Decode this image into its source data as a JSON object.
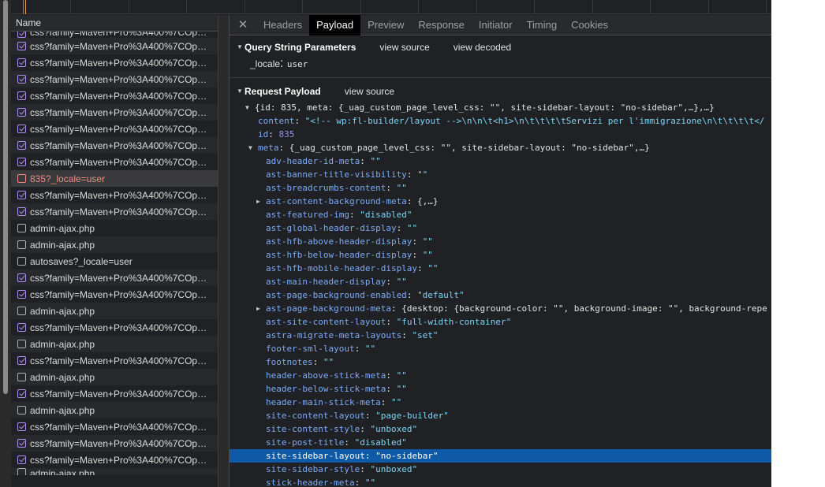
{
  "timeline": {
    "ticks": 13
  },
  "request_list": {
    "header": "Name",
    "rows": [
      {
        "icon": "css-icon",
        "label": "css?family=Maven+Pro%3A400%7COp…",
        "state": "cut"
      },
      {
        "icon": "css-icon",
        "label": "css?family=Maven+Pro%3A400%7COp…"
      },
      {
        "icon": "css-icon",
        "label": "css?family=Maven+Pro%3A400%7COp…"
      },
      {
        "icon": "css-icon",
        "label": "css?family=Maven+Pro%3A400%7COp…"
      },
      {
        "icon": "css-icon",
        "label": "css?family=Maven+Pro%3A400%7COp…"
      },
      {
        "icon": "css-icon",
        "label": "css?family=Maven+Pro%3A400%7COp…"
      },
      {
        "icon": "css-icon",
        "label": "css?family=Maven+Pro%3A400%7COp…"
      },
      {
        "icon": "css-icon",
        "label": "css?family=Maven+Pro%3A400%7COp…"
      },
      {
        "icon": "css-icon",
        "label": "css?family=Maven+Pro%3A400%7COp…"
      },
      {
        "icon": "error-document-icon",
        "label": "835?_locale=user",
        "state": "error"
      },
      {
        "icon": "css-icon",
        "label": "css?family=Maven+Pro%3A400%7COp…"
      },
      {
        "icon": "css-icon",
        "label": "css?family=Maven+Pro%3A400%7COp…"
      },
      {
        "icon": "document-icon",
        "label": "admin-ajax.php"
      },
      {
        "icon": "document-icon",
        "label": "admin-ajax.php"
      },
      {
        "icon": "document-icon",
        "label": "autosaves?_locale=user"
      },
      {
        "icon": "css-icon",
        "label": "css?family=Maven+Pro%3A400%7COp…"
      },
      {
        "icon": "css-icon",
        "label": "css?family=Maven+Pro%3A400%7COp…"
      },
      {
        "icon": "document-icon",
        "label": "admin-ajax.php"
      },
      {
        "icon": "css-icon",
        "label": "css?family=Maven+Pro%3A400%7COp…"
      },
      {
        "icon": "document-icon",
        "label": "admin-ajax.php"
      },
      {
        "icon": "css-icon",
        "label": "css?family=Maven+Pro%3A400%7COp…"
      },
      {
        "icon": "document-icon",
        "label": "admin-ajax.php"
      },
      {
        "icon": "css-icon",
        "label": "css?family=Maven+Pro%3A400%7COp…"
      },
      {
        "icon": "document-icon",
        "label": "admin-ajax.php"
      },
      {
        "icon": "css-icon",
        "label": "css?family=Maven+Pro%3A400%7COp…"
      },
      {
        "icon": "css-icon",
        "label": "css?family=Maven+Pro%3A400%7COp…"
      },
      {
        "icon": "css-icon",
        "label": "css?family=Maven+Pro%3A400%7COp…"
      },
      {
        "icon": "document-icon",
        "label": "admin-ajax.php",
        "state": "cut"
      }
    ]
  },
  "detail": {
    "close_glyph": "✕",
    "tabs": [
      {
        "label": "Headers",
        "active": false
      },
      {
        "label": "Payload",
        "active": true
      },
      {
        "label": "Preview",
        "active": false
      },
      {
        "label": "Response",
        "active": false
      },
      {
        "label": "Initiator",
        "active": false
      },
      {
        "label": "Timing",
        "active": false
      },
      {
        "label": "Cookies",
        "active": false
      }
    ],
    "query": {
      "title": "Query String Parameters",
      "view_source": "view source",
      "view_decoded": "view decoded",
      "params": [
        {
          "key": "_locale",
          "value": "user"
        }
      ]
    },
    "payload": {
      "title": "Request Payload",
      "view_source": "view source",
      "lines": [
        {
          "indent": 0,
          "arrow": "▼",
          "parts": [
            [
              "p",
              "{id: 835, meta: {_uag_custom_page_level_css: \"\", site-sidebar-layout: \"no-sidebar\",…},…}"
            ]
          ]
        },
        {
          "indent": 1,
          "parts": [
            [
              "k",
              "content"
            ],
            [
              "p",
              ": "
            ],
            [
              "s",
              "\"<!-- wp:fl-builder/layout -->\\n\\n\\t<h1>\\n\\t\\t\\t\\tServizi per l'immigrazione\\n\\t\\t\\t\\t</"
            ]
          ]
        },
        {
          "indent": 1,
          "parts": [
            [
              "k",
              "id"
            ],
            [
              "p",
              ": "
            ],
            [
              "n",
              "835"
            ]
          ]
        },
        {
          "indent": 1,
          "arrow": "▼",
          "parts": [
            [
              "k",
              "meta"
            ],
            [
              "p",
              ": {_uag_custom_page_level_css: \"\", site-sidebar-layout: \"no-sidebar\",…}"
            ]
          ]
        },
        {
          "indent": 2,
          "parts": [
            [
              "k",
              "adv-header-id-meta"
            ],
            [
              "p",
              ": "
            ],
            [
              "s",
              "\"\""
            ]
          ]
        },
        {
          "indent": 2,
          "parts": [
            [
              "k",
              "ast-banner-title-visibility"
            ],
            [
              "p",
              ": "
            ],
            [
              "s",
              "\"\""
            ]
          ]
        },
        {
          "indent": 2,
          "parts": [
            [
              "k",
              "ast-breadcrumbs-content"
            ],
            [
              "p",
              ": "
            ],
            [
              "s",
              "\"\""
            ]
          ]
        },
        {
          "indent": 2,
          "arrow": "▶",
          "parts": [
            [
              "k",
              "ast-content-background-meta"
            ],
            [
              "p",
              ": {,…}"
            ]
          ]
        },
        {
          "indent": 2,
          "parts": [
            [
              "k",
              "ast-featured-img"
            ],
            [
              "p",
              ": "
            ],
            [
              "s",
              "\"disabled\""
            ]
          ]
        },
        {
          "indent": 2,
          "parts": [
            [
              "k",
              "ast-global-header-display"
            ],
            [
              "p",
              ": "
            ],
            [
              "s",
              "\"\""
            ]
          ]
        },
        {
          "indent": 2,
          "parts": [
            [
              "k",
              "ast-hfb-above-header-display"
            ],
            [
              "p",
              ": "
            ],
            [
              "s",
              "\"\""
            ]
          ]
        },
        {
          "indent": 2,
          "parts": [
            [
              "k",
              "ast-hfb-below-header-display"
            ],
            [
              "p",
              ": "
            ],
            [
              "s",
              "\"\""
            ]
          ]
        },
        {
          "indent": 2,
          "parts": [
            [
              "k",
              "ast-hfb-mobile-header-display"
            ],
            [
              "p",
              ": "
            ],
            [
              "s",
              "\"\""
            ]
          ]
        },
        {
          "indent": 2,
          "parts": [
            [
              "k",
              "ast-main-header-display"
            ],
            [
              "p",
              ": "
            ],
            [
              "s",
              "\"\""
            ]
          ]
        },
        {
          "indent": 2,
          "parts": [
            [
              "k",
              "ast-page-background-enabled"
            ],
            [
              "p",
              ": "
            ],
            [
              "s",
              "\"default\""
            ]
          ]
        },
        {
          "indent": 2,
          "arrow": "▶",
          "parts": [
            [
              "k",
              "ast-page-background-meta"
            ],
            [
              "p",
              ": {desktop: {background-color: \"\", background-image: \"\", background-repe"
            ]
          ]
        },
        {
          "indent": 2,
          "parts": [
            [
              "k",
              "ast-site-content-layout"
            ],
            [
              "p",
              ": "
            ],
            [
              "s",
              "\"full-width-container\""
            ]
          ]
        },
        {
          "indent": 2,
          "parts": [
            [
              "k",
              "astra-migrate-meta-layouts"
            ],
            [
              "p",
              ": "
            ],
            [
              "s",
              "\"set\""
            ]
          ]
        },
        {
          "indent": 2,
          "parts": [
            [
              "k",
              "footer-sml-layout"
            ],
            [
              "p",
              ": "
            ],
            [
              "s",
              "\"\""
            ]
          ]
        },
        {
          "indent": 2,
          "parts": [
            [
              "k",
              "footnotes"
            ],
            [
              "p",
              ": "
            ],
            [
              "s",
              "\"\""
            ]
          ]
        },
        {
          "indent": 2,
          "parts": [
            [
              "k",
              "header-above-stick-meta"
            ],
            [
              "p",
              ": "
            ],
            [
              "s",
              "\"\""
            ]
          ]
        },
        {
          "indent": 2,
          "parts": [
            [
              "k",
              "header-below-stick-meta"
            ],
            [
              "p",
              ": "
            ],
            [
              "s",
              "\"\""
            ]
          ]
        },
        {
          "indent": 2,
          "parts": [
            [
              "k",
              "header-main-stick-meta"
            ],
            [
              "p",
              ": "
            ],
            [
              "s",
              "\"\""
            ]
          ]
        },
        {
          "indent": 2,
          "parts": [
            [
              "k",
              "site-content-layout"
            ],
            [
              "p",
              ": "
            ],
            [
              "s",
              "\"page-builder\""
            ]
          ]
        },
        {
          "indent": 2,
          "parts": [
            [
              "k",
              "site-content-style"
            ],
            [
              "p",
              ": "
            ],
            [
              "s",
              "\"unboxed\""
            ]
          ]
        },
        {
          "indent": 2,
          "parts": [
            [
              "k",
              "site-post-title"
            ],
            [
              "p",
              ": "
            ],
            [
              "s",
              "\"disabled\""
            ]
          ]
        },
        {
          "indent": 2,
          "selected": true,
          "parts": [
            [
              "k",
              "site-sidebar-layout"
            ],
            [
              "p",
              ": "
            ],
            [
              "s",
              "\"no-sidebar\""
            ]
          ]
        },
        {
          "indent": 2,
          "parts": [
            [
              "k",
              "site-sidebar-style"
            ],
            [
              "p",
              ": "
            ],
            [
              "s",
              "\"unboxed\""
            ]
          ]
        },
        {
          "indent": 2,
          "parts": [
            [
              "k",
              "stick-header-meta"
            ],
            [
              "p",
              ": "
            ],
            [
              "s",
              "\"\""
            ]
          ]
        }
      ]
    }
  }
}
